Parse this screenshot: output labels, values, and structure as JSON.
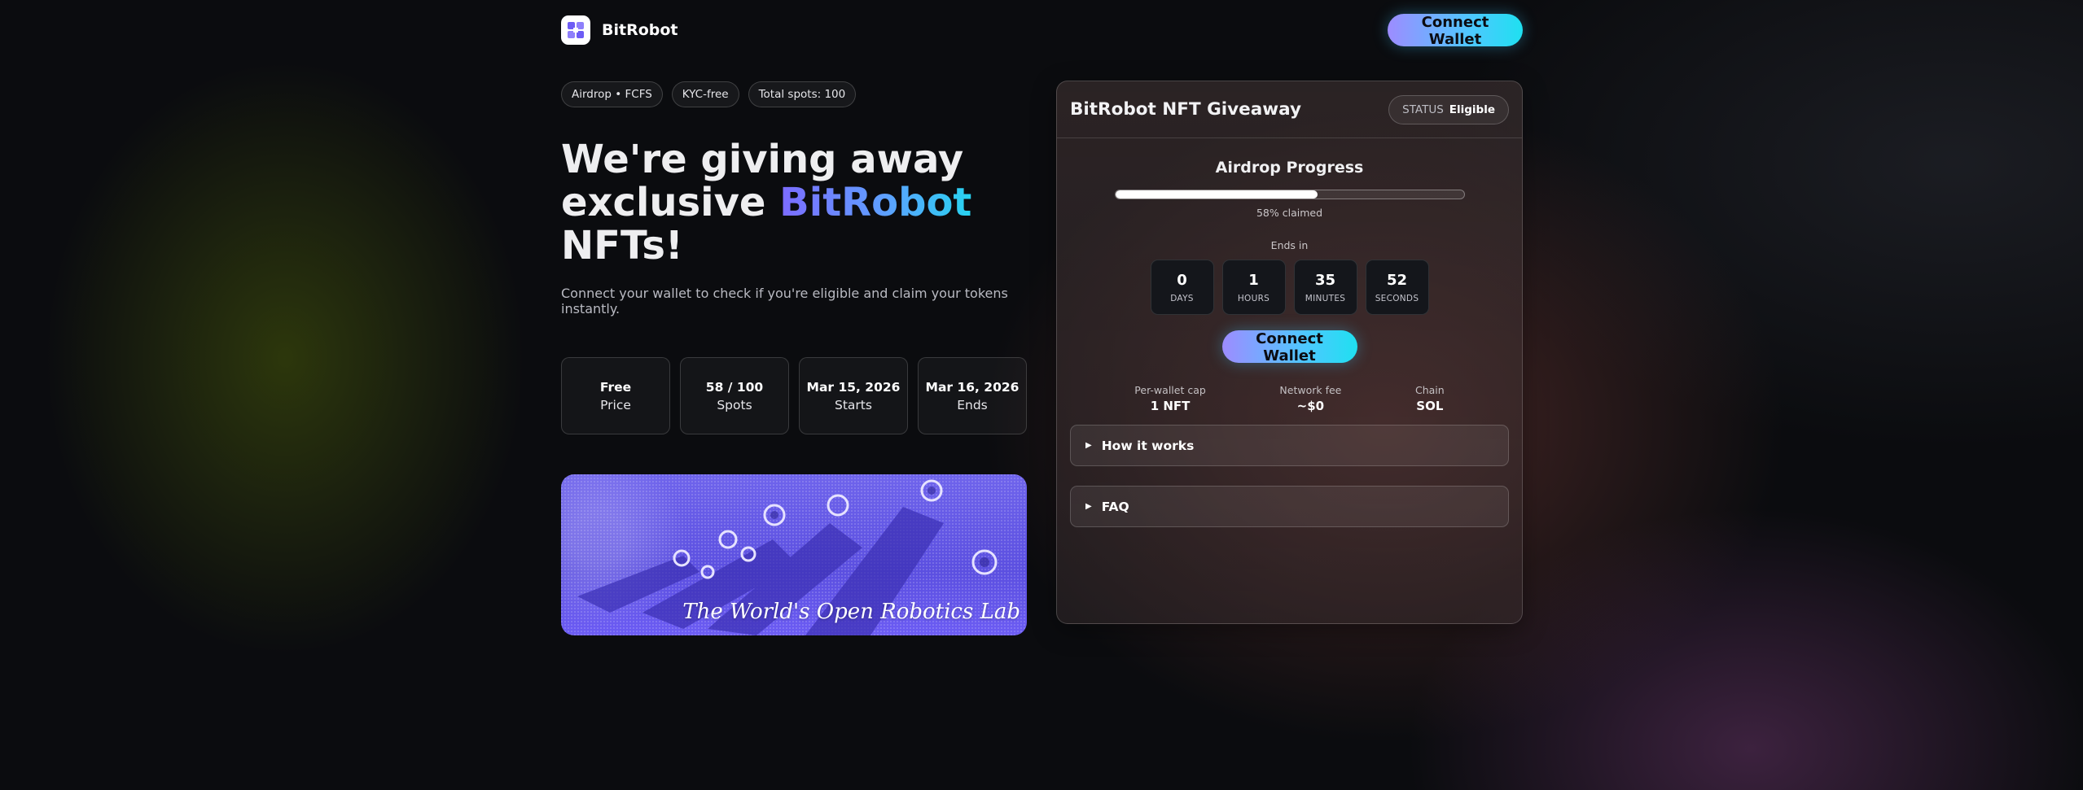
{
  "header": {
    "brand_name": "BitRobot",
    "connect_label": "Connect Wallet"
  },
  "chips": [
    "Airdrop • FCFS",
    "KYC-free",
    "Total spots: 100"
  ],
  "hero": {
    "title_line1": "We're giving away",
    "title_line2_prefix": "exclusive ",
    "title_highlight": "BitRobot",
    "title_line3": "NFTs!",
    "subtitle": "Connect your wallet to check if you're eligible and claim your tokens instantly."
  },
  "stats": [
    {
      "value": "Free",
      "label": "Price"
    },
    {
      "value": "58 / 100",
      "label": "Spots"
    },
    {
      "value": "Mar 15, 2026",
      "label": "Starts"
    },
    {
      "value": "Mar 16, 2026",
      "label": "Ends"
    }
  ],
  "banner": {
    "caption": "The World's Open Robotics Lab"
  },
  "card": {
    "title": "BitRobot NFT Giveaway",
    "status_key": "STATUS",
    "status_value": "Eligible",
    "progress_title": "Airdrop Progress",
    "progress_fraction": 0.58,
    "progress_caption": "58% claimed",
    "ends_label": "Ends in",
    "timer": [
      {
        "value": "0",
        "unit": "DAYS"
      },
      {
        "value": "1",
        "unit": "HOURS"
      },
      {
        "value": "35",
        "unit": "MINUTES"
      },
      {
        "value": "52",
        "unit": "SECONDS"
      }
    ],
    "connect_label": "Connect Wallet",
    "meta": [
      {
        "key": "Per-wallet cap",
        "value": "1 NFT"
      },
      {
        "key": "Network fee",
        "value": "~$0"
      },
      {
        "key": "Chain",
        "value": "SOL"
      }
    ],
    "accordions": [
      {
        "label": "How it works"
      },
      {
        "label": "FAQ"
      }
    ]
  },
  "colors": {
    "accent_gradient_start": "#9d8cff",
    "accent_gradient_end": "#1fe0f0",
    "banner_purple": "#5b4fe0"
  },
  "icons": {
    "logo": "bitrobot-logo-icon",
    "accordion": "triangle-right-icon"
  }
}
